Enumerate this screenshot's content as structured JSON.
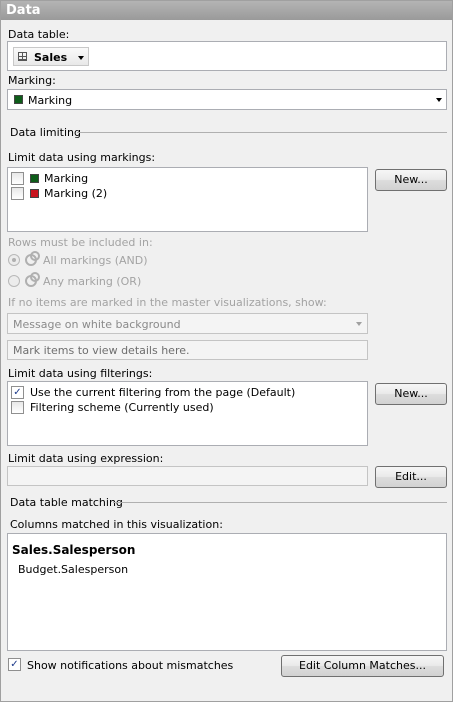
{
  "header": {
    "title": "Data"
  },
  "data_table": {
    "label": "Data table:",
    "value": "Sales"
  },
  "marking": {
    "label": "Marking:",
    "value": "Marking",
    "color": "#0e5d1a"
  },
  "data_limiting": {
    "section_title": "Data limiting",
    "markings_label": "Limit data using markings:",
    "markings": [
      {
        "label": "Marking",
        "checked": false,
        "color": "#0e5d1a"
      },
      {
        "label": "Marking (2)",
        "checked": false,
        "color": "#c8141e"
      }
    ],
    "new_button": "New...",
    "rows_label": "Rows must be included in:",
    "radio_all": "All markings (AND)",
    "radio_any": "Any marking (OR)",
    "no_items_label": "If no items are marked in the master visualizations, show:",
    "no_items_value": "Message on white background",
    "message_text": "Mark items to view details here.",
    "filterings_label": "Limit data using filterings:",
    "filterings": [
      {
        "label": "Use the current filtering from the page (Default)",
        "checked": true
      },
      {
        "label": "Filtering scheme (Currently used)",
        "checked": false
      }
    ],
    "filter_new_button": "New...",
    "expression_label": "Limit data using expression:",
    "expression_value": "",
    "edit_button": "Edit..."
  },
  "table_matching": {
    "section_title": "Data table matching",
    "columns_label": "Columns matched in this visualization:",
    "primary_column": "Sales.Salesperson",
    "matched_column": "Budget.Salesperson",
    "notify_label": "Show notifications about mismatches",
    "notify_checked": true,
    "edit_matches_button": "Edit Column Matches..."
  }
}
